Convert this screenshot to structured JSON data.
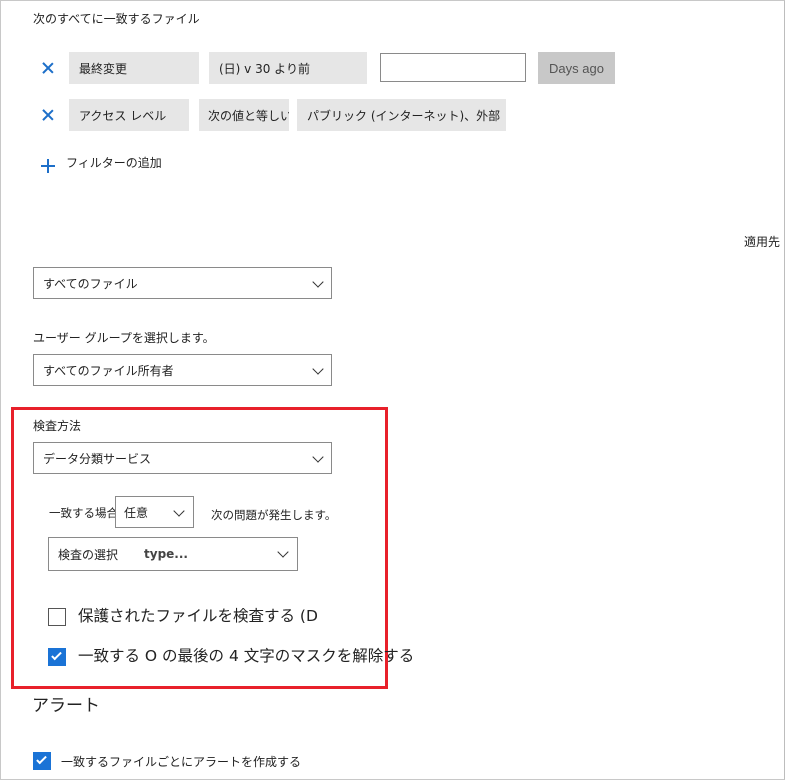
{
  "filters": {
    "heading": "次のすべてに一致するファイル",
    "rows": [
      {
        "field": "最終変更",
        "operator": "(日) v 30 より前",
        "value": "",
        "unit_button": "Days ago"
      },
      {
        "field": "アクセス レベル",
        "operator": "次の値と等しい",
        "value": "パブリック (インターネット)、外部"
      }
    ],
    "add_filter_label": "フィルターの追加"
  },
  "apply_to": {
    "label": "適用先",
    "files_dropdown": "すべてのファイル",
    "user_group_label": "ユーザー グループを選択します。",
    "user_group_dropdown": "すべてのファイル所有者"
  },
  "inspection": {
    "label": "検査方法",
    "method_dropdown": "データ分類サービス",
    "match_prefix": "一致する場合",
    "match_dropdown": "任意",
    "match_suffix": "次の問題が発生します。",
    "select_prefix": "検査の選択",
    "select_placeholder": "type...",
    "protected_files_label": "保護されたファイルを検査する (D",
    "protected_files_checked": false,
    "unmask_label": "一致する O の最後の 4 文字のマスクを解除する",
    "unmask_checked": true
  },
  "alerts": {
    "heading": "アラート",
    "create_alert_label": "一致するファイルごとにアラートを作成する",
    "create_alert_checked": true
  },
  "colors": {
    "accent": "#1a73d6",
    "highlight_frame": "#e8202a",
    "field_bg": "#e6e6e6",
    "disabled_button": "#c8c8c8"
  }
}
